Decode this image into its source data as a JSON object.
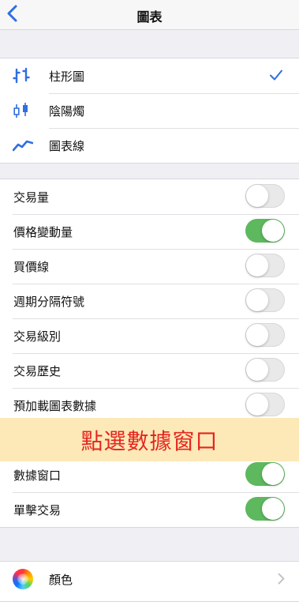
{
  "nav": {
    "title": "圖表"
  },
  "chart_types": [
    {
      "label": "柱形圖",
      "icon": "bar-chart-icon",
      "selected": true
    },
    {
      "label": "陰陽燭",
      "icon": "candlestick-icon",
      "selected": false
    },
    {
      "label": "圖表線",
      "icon": "line-chart-icon",
      "selected": false
    }
  ],
  "toggles": [
    {
      "label": "交易量",
      "on": false
    },
    {
      "label": "價格變動量",
      "on": true
    },
    {
      "label": "買價線",
      "on": false
    },
    {
      "label": "週期分隔符號",
      "on": false
    },
    {
      "label": "交易級別",
      "on": false
    },
    {
      "label": "交易歷史",
      "on": false
    },
    {
      "label": "預加載圖表數據",
      "on": false
    },
    {
      "label": "",
      "on": false
    },
    {
      "label": "數據窗口",
      "on": true
    },
    {
      "label": "單擊交易",
      "on": true
    }
  ],
  "banner": {
    "text": "點選數據窗口"
  },
  "color_row": {
    "label": "顏色",
    "icon": "color-wheel-icon"
  },
  "colors": {
    "accent": "#2f6fe0",
    "toggle_on": "#5db85e",
    "banner_bg": "#fde9b8",
    "banner_text": "#e5251f"
  }
}
